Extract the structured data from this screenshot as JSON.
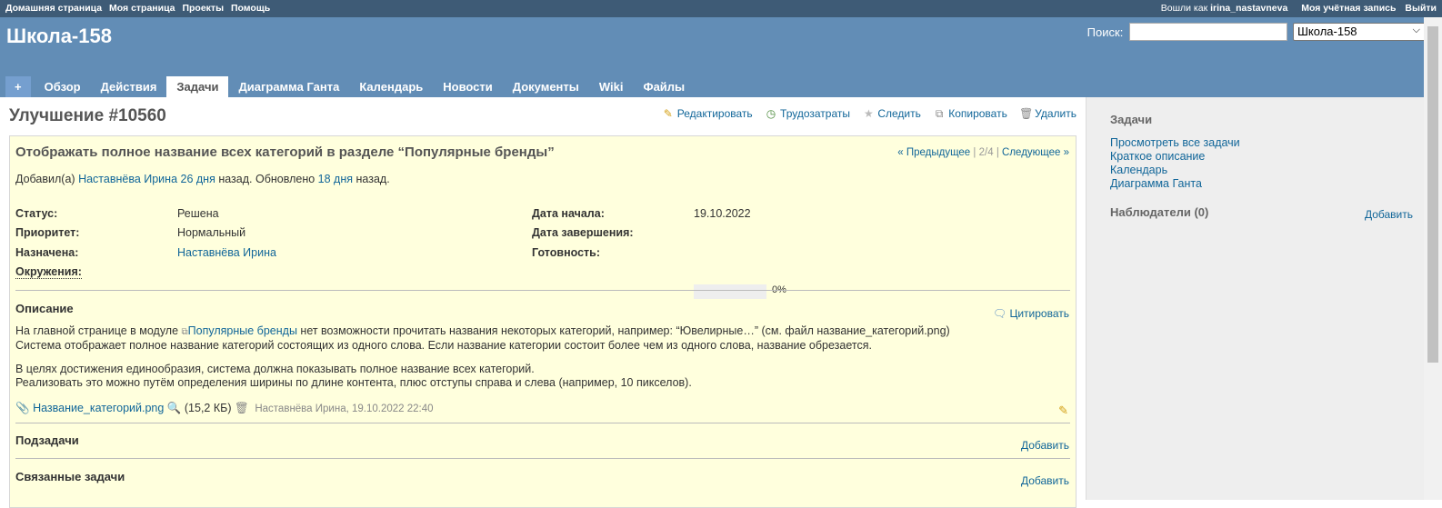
{
  "top_menu": {
    "home": "Домашняя страница",
    "my_page": "Моя страница",
    "projects": "Проекты",
    "help": "Помощь",
    "logged_as": "Вошли как",
    "username": "irina_nastavneva",
    "my_account": "Моя учётная запись",
    "logout": "Выйти"
  },
  "header": {
    "title": "Школа-158",
    "search_label": "Поиск:",
    "search_value": "",
    "project_select": "Школа-158"
  },
  "tabs": [
    {
      "label": "+"
    },
    {
      "label": "Обзор"
    },
    {
      "label": "Действия"
    },
    {
      "label": "Задачи"
    },
    {
      "label": "Диаграмма Ганта"
    },
    {
      "label": "Календарь"
    },
    {
      "label": "Новости"
    },
    {
      "label": "Документы"
    },
    {
      "label": "Wiki"
    },
    {
      "label": "Файлы"
    }
  ],
  "issue": {
    "heading": "Улучшение #10560",
    "actions": {
      "edit": "Редактировать",
      "time": "Трудозатраты",
      "watch": "Следить",
      "copy": "Копировать",
      "delete": "Удалить"
    },
    "subject": "Отображать полное название всех категорий в разделе “Популярные бренды”",
    "nav": {
      "prev": "« Предыдущее",
      "sep1": "|",
      "position": "2/4",
      "sep2": "|",
      "next": "Следующее »"
    },
    "author": {
      "added_by": "Добавил(а)",
      "name": "Наставнёва Ирина",
      "created": "26 дня",
      "after": "назад. Обновлено",
      "updated": "18 дня",
      "end": "назад."
    },
    "attributes": {
      "status_label": "Статус:",
      "status": "Решена",
      "priority_label": "Приоритет:",
      "priority": "Нормальный",
      "assignee_label": "Назначена:",
      "assignee": "Наставнёва Ирина",
      "env_label": "Окружения:",
      "start_label": "Дата начала:",
      "start": "19.10.2022",
      "due_label": "Дата завершения:",
      "done_label": "Готовность:",
      "done_text": "0%",
      "done_ratio": 0
    },
    "description": {
      "title": "Описание",
      "quote": "Цитировать",
      "line1_a": "На главной странице в модуле",
      "line1_link": "Популярные бренды",
      "line1_b": "нет возможности прочитать названия некоторых категорий, например: “Ювелирные…” (см. файл название_категорий.png)",
      "line2": "Система отображает полное название категорий состоящих из одного слова. Если название категории состоит более чем из одного слова, название обрезается.",
      "line3": "В целях достижения единообразия, система должна показывать полное название всех категорий.",
      "line4": "Реализовать это можно путём определения ширины по длине контента, плюс отступы справа и слева (например, 10 пикселов)."
    },
    "attachment": {
      "name": "Название_категорий.png",
      "size": "(15,2 КБ)",
      "meta": "Наставнёва Ирина, 19.10.2022 22:40"
    },
    "subtasks": {
      "title": "Подзадачи",
      "add": "Добавить"
    },
    "relations": {
      "title": "Связанные задачи",
      "add": "Добавить"
    }
  },
  "sidebar": {
    "title": "Задачи",
    "links": [
      "Просмотреть все задачи",
      "Краткое описание",
      "Календарь",
      "Диаграмма Ганта"
    ],
    "watchers": "Наблюдатели (0)",
    "add": "Добавить"
  }
}
